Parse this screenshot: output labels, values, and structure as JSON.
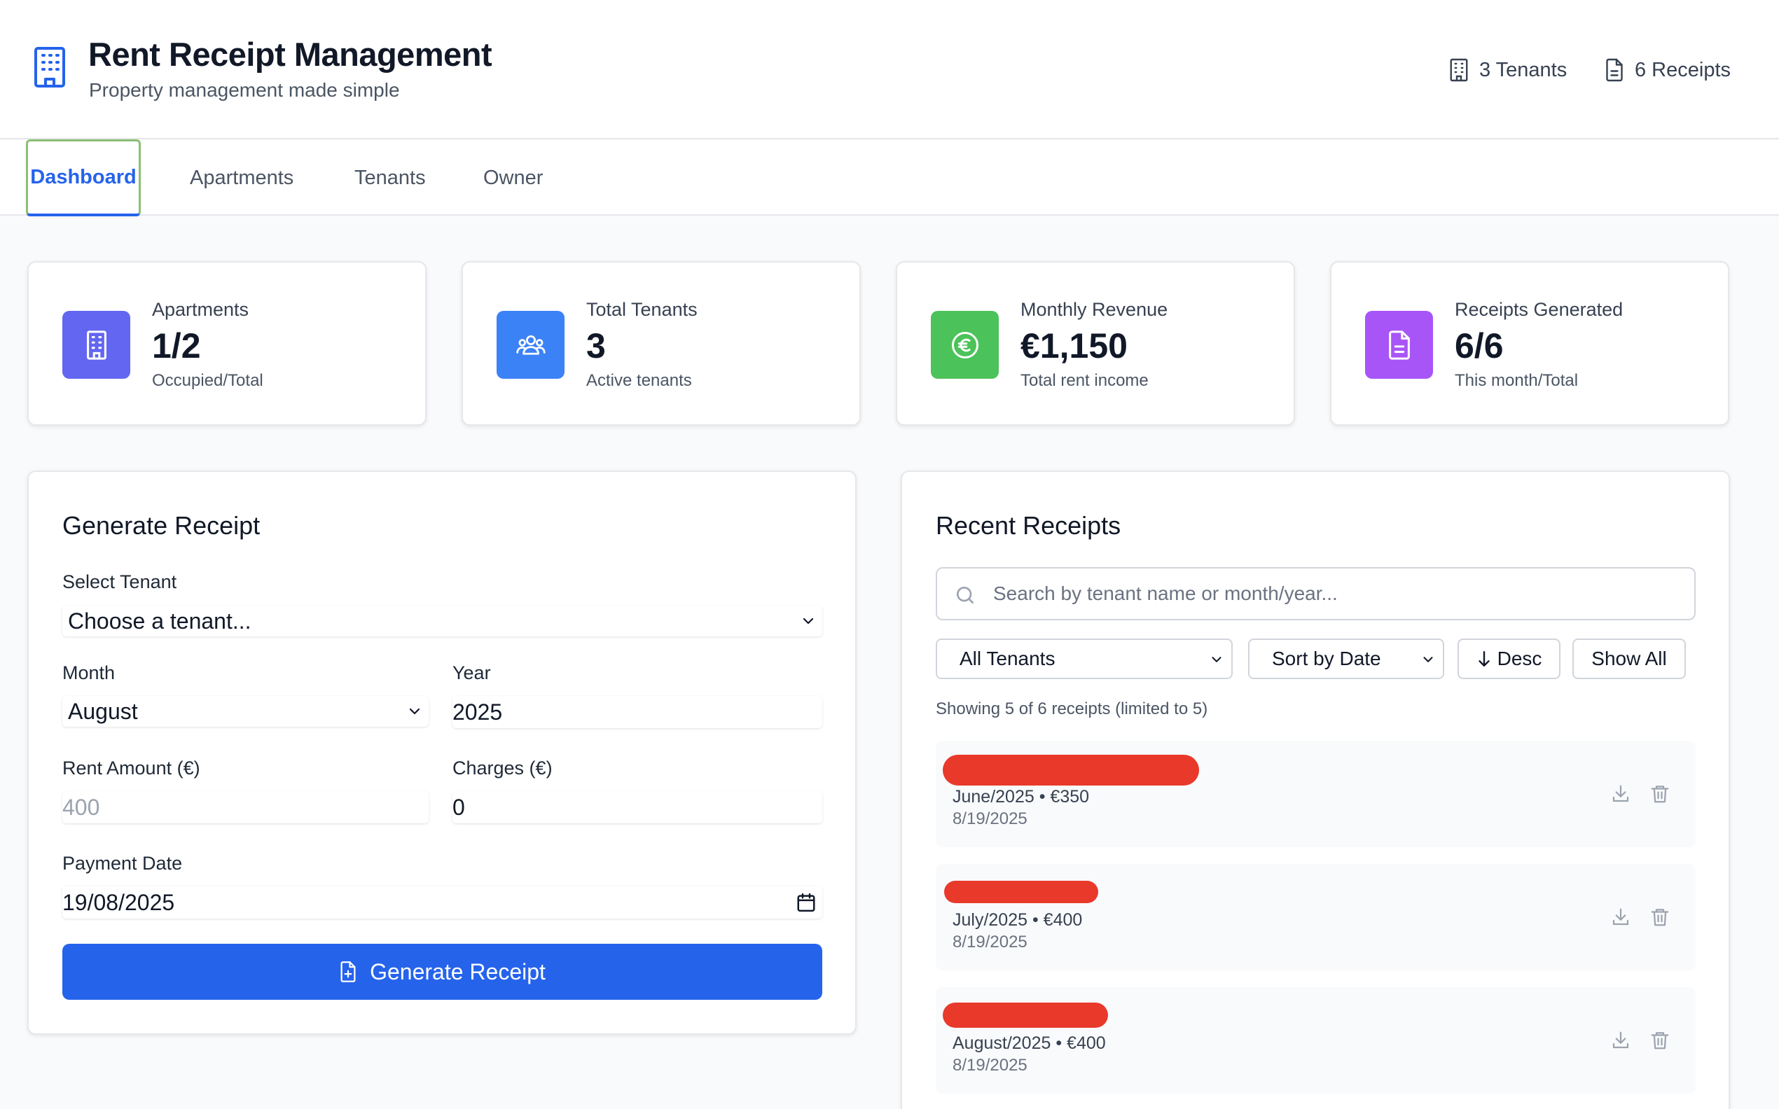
{
  "header": {
    "title": "Rent Receipt Management",
    "subtitle": "Property management made simple",
    "tenants_count": "3 Tenants",
    "receipts_count": "6 Receipts"
  },
  "tabs": [
    "Dashboard",
    "Apartments",
    "Tenants",
    "Owner"
  ],
  "active_tab": "Dashboard",
  "stats": [
    {
      "label": "Apartments",
      "value": "1/2",
      "sub": "Occupied/Total",
      "icon": "building-icon",
      "color": "#6366f1"
    },
    {
      "label": "Total Tenants",
      "value": "3",
      "sub": "Active tenants",
      "icon": "users-icon",
      "color": "#3b82f6"
    },
    {
      "label": "Monthly Revenue",
      "value": "€1,150",
      "sub": "Total rent income",
      "icon": "euro-icon",
      "color": "#4cc25a"
    },
    {
      "label": "Receipts Generated",
      "value": "6/6",
      "sub": "This month/Total",
      "icon": "file-icon",
      "color": "#a855f7"
    }
  ],
  "generate": {
    "title": "Generate Receipt",
    "tenant_label": "Select Tenant",
    "tenant_value": "Choose a tenant...",
    "month_label": "Month",
    "month_value": "August",
    "year_label": "Year",
    "year_value": "2025",
    "rent_label": "Rent Amount (€)",
    "rent_placeholder": "400",
    "charges_label": "Charges (€)",
    "charges_value": "0",
    "payment_label": "Payment Date",
    "payment_value": "19/08/2025",
    "button_label": "Generate Receipt"
  },
  "recent": {
    "title": "Recent Receipts",
    "search_placeholder": "Search by tenant name or month/year...",
    "filter_tenants": "All Tenants",
    "sort_by": "Sort by Date",
    "order": "Desc",
    "show_all": "Show All",
    "showing_text": "Showing 5 of 6 receipts (limited to 5)",
    "receipts": [
      {
        "meta": "June/2025 • €350",
        "date": "8/19/2025"
      },
      {
        "meta": "July/2025 • €400",
        "date": "8/19/2025"
      },
      {
        "meta": "August/2025 • €400",
        "date": "8/19/2025"
      }
    ]
  },
  "colors": {
    "primary": "#2563eb",
    "redaction": "#e8392b"
  }
}
